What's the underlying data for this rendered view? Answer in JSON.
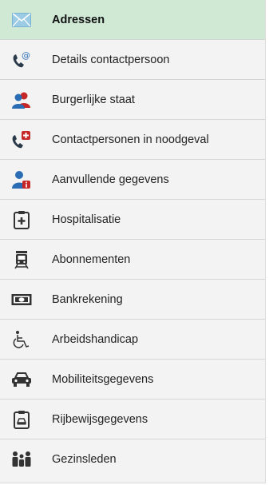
{
  "menu": {
    "items": [
      {
        "label": "Adressen",
        "icon": "envelope-icon",
        "active": true
      },
      {
        "label": "Details contactpersoon",
        "icon": "phone-at-icon"
      },
      {
        "label": "Burgerlijke staat",
        "icon": "two-people-icon"
      },
      {
        "label": "Contactpersonen in noodgeval",
        "icon": "phone-emergency-icon"
      },
      {
        "label": "Aanvullende gegevens",
        "icon": "person-info-icon"
      },
      {
        "label": "Hospitalisatie",
        "icon": "medical-clipboard-icon"
      },
      {
        "label": "Abonnementen",
        "icon": "train-icon"
      },
      {
        "label": "Bankrekening",
        "icon": "banknote-icon"
      },
      {
        "label": "Arbeidshandicap",
        "icon": "wheelchair-icon"
      },
      {
        "label": "Mobiliteitsgegevens",
        "icon": "car-icon"
      },
      {
        "label": "Rijbewijsgegevens",
        "icon": "license-clipboard-icon"
      },
      {
        "label": "Gezinsleden",
        "icon": "family-icon"
      }
    ]
  },
  "colors": {
    "active_background": "#cfe9d5",
    "item_background": "#f3f3f3",
    "icon_dark": "#333333",
    "icon_blue": "#2a6db5",
    "icon_red": "#c62828",
    "envelope": "#9ccbe5"
  }
}
